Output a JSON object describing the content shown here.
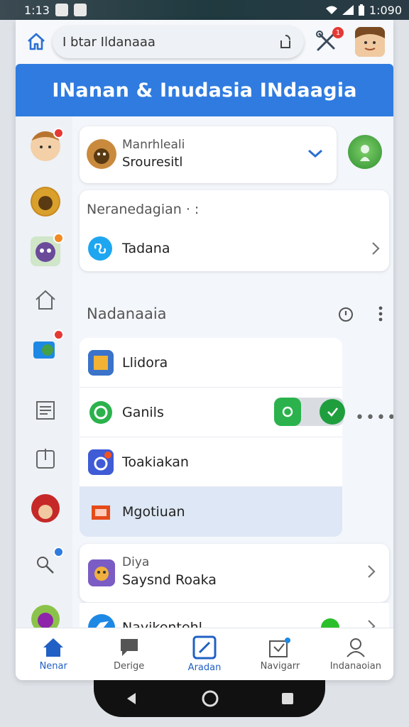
{
  "status_bar": {
    "time_left": "1:13",
    "time_right": "1:090"
  },
  "topbar": {
    "search_value": "I btar Ildanaaa",
    "badge_count": "1"
  },
  "header": {
    "title": "INanan & Inudasia   INdaagia"
  },
  "account": {
    "label": "Manrhleali",
    "value": "Srouresitl"
  },
  "section1": {
    "title": "Neranedagian · :",
    "row_label": "Tadana"
  },
  "group": {
    "title": "Nadanaaia",
    "items": [
      {
        "label": "Llidora"
      },
      {
        "label": "Ganils"
      },
      {
        "label": "Toakiakan"
      },
      {
        "label": "Mgotiuan"
      }
    ]
  },
  "card_bottom1": {
    "label": "Diya",
    "value": "Saysnd Roaka"
  },
  "card_bottom2": {
    "label": "Nayikentehl"
  },
  "bottom_nav": [
    {
      "label": "Nenar",
      "icon": "home-icon"
    },
    {
      "label": "Derige",
      "icon": "chat-icon"
    },
    {
      "label": "Aradan",
      "icon": "edit-icon"
    },
    {
      "label": "Navigarr",
      "icon": "inbox-icon"
    },
    {
      "label": "Indanaoian",
      "icon": "profile-icon"
    }
  ],
  "colors": {
    "accent": "#2f7be0",
    "toggle_on": "#2bb24c",
    "status_dot": "#2bc02b",
    "badge": "#e53935"
  }
}
